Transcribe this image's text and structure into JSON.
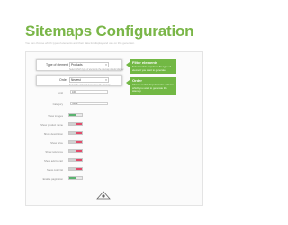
{
  "page": {
    "title": "Sitemaps Configuration",
    "subtitle": "You can choose which type of elements and their data for display and use on this generator."
  },
  "highlighted": [
    {
      "label": "Type of element",
      "value": "Products",
      "help": "Select which type of elements the sitemap should display"
    },
    {
      "label": "Order",
      "value": "Newest",
      "help": "Select the order of elements in the sitemap"
    }
  ],
  "tooltips": [
    {
      "title": "Filter elements",
      "body": "Select in this dropdown the type of element you want to generate"
    },
    {
      "title": "Order",
      "body": "Choose in this dropdown the order in which you want to generate the sitemap"
    }
  ],
  "fields": [
    {
      "label": "Limit",
      "type": "select",
      "value": "100"
    },
    {
      "label": "Category",
      "type": "select",
      "value": "Home"
    },
    {
      "label": "Show images",
      "type": "toggle",
      "state": "on"
    },
    {
      "label": "Show product name",
      "type": "toggle",
      "state": "off"
    },
    {
      "label": "Show description",
      "type": "toggle",
      "state": "off"
    },
    {
      "label": "Show price",
      "type": "toggle",
      "state": "off"
    },
    {
      "label": "Show reference",
      "type": "toggle",
      "state": "off"
    },
    {
      "label": "Show add to cart",
      "type": "toggle",
      "state": "off"
    },
    {
      "label": "Show color list",
      "type": "toggle",
      "state": "off"
    },
    {
      "label": "Enable pagination",
      "type": "toggle",
      "state": "on"
    }
  ],
  "colors": {
    "accent": "#7ab648",
    "toggle_off": "#e24c6b",
    "toggle_on": "#5ab36f"
  },
  "icons": {
    "dropdown": "chevron-down-icon",
    "brand": "brand-logo-icon"
  }
}
